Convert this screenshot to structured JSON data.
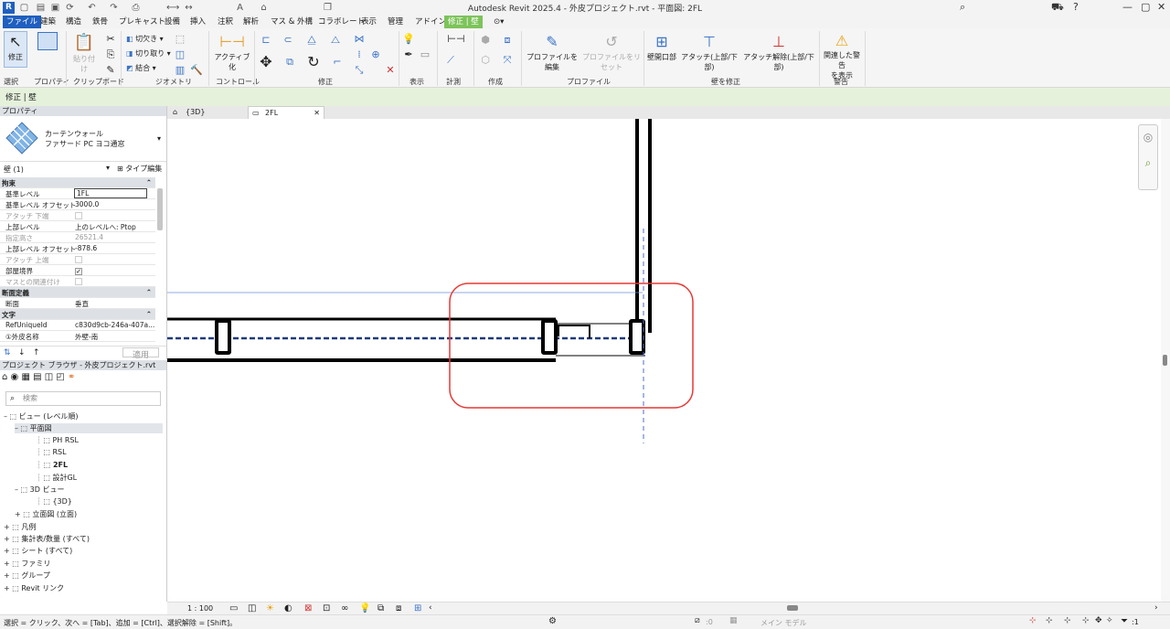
{
  "window": {
    "title": "Autodesk Revit 2025.4 - 外皮プロジェクト.rvt - 平面図: 2FL",
    "logo": "R"
  },
  "menu": {
    "file": "ファイル",
    "items": [
      "建築",
      "構造",
      "鉄骨",
      "プレキャスト",
      "設備",
      "挿入",
      "注釈",
      "解析",
      "マス & 外構",
      "コラボレート",
      "表示",
      "管理",
      "アドイン"
    ],
    "context_tab": "修正 | 壁"
  },
  "ribbon": {
    "modify": "修正",
    "select": "選択",
    "properties": "プロパティ",
    "cut": "切欠き",
    "uncut": "切り取り",
    "join": "結合",
    "paste": "貼り付け",
    "clipboard": "クリップボード",
    "geometry": "ジオメトリ",
    "activate": "アクティブ化",
    "controls": "コントロール",
    "modify_panel": "修正",
    "view": "表示",
    "measure": "計測",
    "create": "作成",
    "edit_profile": "プロファイルを編集",
    "reset_profile": "プロファイルをリセット",
    "profile": "プロファイル",
    "wall_opening": "壁開口部",
    "attach": "アタッチ(上部/下部)",
    "detach": "アタッチ解除(上部/下部)",
    "modify_wall": "壁を修正",
    "show_warnings_1": "関連した警告",
    "show_warnings_2": "を表示",
    "warnings": "警告"
  },
  "context_bar": "修正 | 壁",
  "properties": {
    "title": "プロパティ",
    "type_family": "カーテンウォール",
    "type_name": "ファサード PC ヨコ通窓",
    "instance": "壁 (1)",
    "edit_type": "タイプ編集",
    "apply": "適用",
    "rows": [
      {
        "kind": "group",
        "name": "拘束"
      },
      {
        "kind": "input",
        "name": "基準レベル",
        "value": "1FL"
      },
      {
        "kind": "text",
        "name": "基準レベル オフセット",
        "value": "3000.0"
      },
      {
        "kind": "check-dis",
        "name": "アタッチ 下端",
        "value": ""
      },
      {
        "kind": "text",
        "name": "上部レベル",
        "value": "上のレベルへ: Ptop"
      },
      {
        "kind": "dis",
        "name": "指定高さ",
        "value": "26521.4"
      },
      {
        "kind": "text",
        "name": "上部レベル オフセット",
        "value": "-878.6"
      },
      {
        "kind": "check-dis",
        "name": "アタッチ 上端",
        "value": ""
      },
      {
        "kind": "check-on",
        "name": "部屋境界",
        "value": ""
      },
      {
        "kind": "check-dis",
        "name": "マスとの関連付け",
        "value": ""
      },
      {
        "kind": "group",
        "name": "断面定義"
      },
      {
        "kind": "text",
        "name": "断面",
        "value": "垂直"
      },
      {
        "kind": "group",
        "name": "文字"
      },
      {
        "kind": "text",
        "name": "RefUniqueId",
        "value": "c830d9cb-246a-407a..."
      },
      {
        "kind": "text",
        "name": "①外皮名称",
        "value": "外壁-南"
      }
    ]
  },
  "browser": {
    "title": "プロジェクト ブラウザ - 外皮プロジェクト.rvt",
    "search_placeholder": "検索",
    "tree": [
      {
        "label": "ビュー (レベル順)",
        "indent": 0,
        "sign": "–"
      },
      {
        "label": "平面図",
        "indent": 1,
        "sign": "–",
        "selected": true
      },
      {
        "label": "PH RSL",
        "indent": 3
      },
      {
        "label": "RSL",
        "indent": 3
      },
      {
        "label": "2FL",
        "indent": 3,
        "bold": true
      },
      {
        "label": "設計GL",
        "indent": 3
      },
      {
        "label": "3D ビュー",
        "indent": 1,
        "sign": "–"
      },
      {
        "label": "{3D}",
        "indent": 3
      },
      {
        "label": "立面図 (立面)",
        "indent": 1,
        "sign": "+"
      },
      {
        "label": "凡例",
        "indent": 0,
        "sign": "+"
      },
      {
        "label": "集計表/数量 (すべて)",
        "indent": 0,
        "sign": "+"
      },
      {
        "label": "シート (すべて)",
        "indent": 0,
        "sign": "+"
      },
      {
        "label": "ファミリ",
        "indent": 0,
        "sign": "+"
      },
      {
        "label": "グループ",
        "indent": 0,
        "sign": "+"
      },
      {
        "label": "Revit リンク",
        "indent": 0,
        "sign": "+"
      }
    ]
  },
  "tabs": [
    {
      "label": "{3D}",
      "active": false
    },
    {
      "label": "2FL",
      "active": true
    }
  ],
  "viewbar": {
    "scale": "1 : 100"
  },
  "status": {
    "hint": "選択 = クリック、次へ = [Tab]、追加 = [Ctrl]、選択解除 = [Shift]。",
    "count": ":0",
    "model": "メイン モデル",
    "filter": ":1"
  },
  "colors": {
    "file_tab": "#1f5fbf",
    "context_tab": "#7dc35b",
    "highlight": "#e53935"
  }
}
